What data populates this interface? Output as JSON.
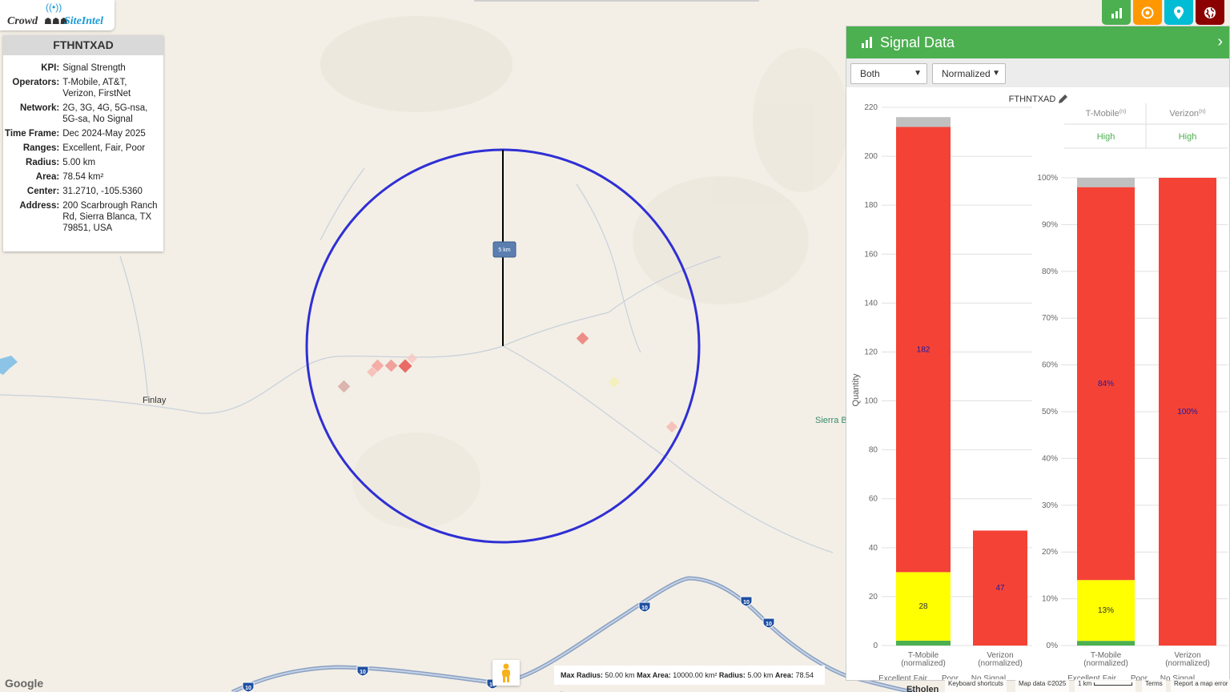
{
  "logo": {
    "crowd": "Crowd",
    "site": "SiteIntel"
  },
  "info": {
    "title": "FTHNTXAD",
    "rows": [
      {
        "k": "KPI:",
        "v": "Signal Strength"
      },
      {
        "k": "Operators:",
        "v": "T-Mobile, AT&T, Verizon, FirstNet"
      },
      {
        "k": "Network:",
        "v": "2G, 3G, 4G, 5G-nsa, 5G-sa, No Signal"
      },
      {
        "k": "Time Frame:",
        "v": "Dec 2024-May 2025"
      },
      {
        "k": "Ranges:",
        "v": "Excellent, Fair, Poor"
      },
      {
        "k": "Radius:",
        "v": "5.00 km"
      },
      {
        "k": "Area:",
        "v": "78.54 km²"
      },
      {
        "k": "Center:",
        "v": "31.2710, -105.5360"
      },
      {
        "k": "Address:",
        "v": "200 Scarbrough Ranch Rd, Sierra Blanca, TX 79851, USA"
      }
    ]
  },
  "map": {
    "labels": {
      "finlay": "Finlay",
      "sierra": "Sierra B",
      "etholen": "Etholen",
      "radius_label": "5 km"
    },
    "shields": [
      "10",
      "10",
      "10",
      "10",
      "10",
      "10"
    ],
    "max_bar": {
      "k1": "Max Radius:",
      "v1": "50.00 km",
      "k2": "Max Area:",
      "v2": "10000.00 km²",
      "k3": "Radius:",
      "v3": "5.00 km",
      "k4": "Area:",
      "v4": "78.54 km²"
    },
    "google": "Google",
    "footer": {
      "keyboard": "Keyboard shortcuts",
      "mapdata": "Map data ©2025",
      "scale": "1 km",
      "terms": "Terms",
      "report": "Report a map error"
    },
    "circle_color": "#2f2fd4"
  },
  "buttons": [
    {
      "name": "chart-icon",
      "color": "#4caf50"
    },
    {
      "name": "target-icon",
      "color": "#ff9800"
    },
    {
      "name": "location-pin-icon",
      "color": "#00bcd4"
    },
    {
      "name": "globe-icon",
      "color": "#8b0000"
    }
  ],
  "panel": {
    "title": "Signal Data",
    "select_operator": "Both",
    "select_mode": "Normalized",
    "chart_title": "FTHNTXAD"
  },
  "chart_data": [
    {
      "type": "bar",
      "stacked": true,
      "title": "FTHNTXAD",
      "ylabel": "Quantity",
      "ylim": [
        0,
        220
      ],
      "yticks": [
        0,
        20,
        40,
        60,
        80,
        100,
        120,
        140,
        160,
        180,
        200,
        220
      ],
      "categories": [
        "T-Mobile (normalized)",
        "Verizon (normalized)"
      ],
      "category_lines": [
        [
          "T-Mobile",
          "(normalized)"
        ],
        [
          "Verizon",
          "(normalized)"
        ]
      ],
      "series": [
        {
          "name": "Excellent",
          "color": "#4caf50",
          "values": [
            2,
            0
          ]
        },
        {
          "name": "Fair",
          "color": "#ffff00",
          "values": [
            28,
            0
          ]
        },
        {
          "name": "Poor",
          "color": "#f44336",
          "values": [
            182,
            47
          ]
        },
        {
          "name": "No Signal",
          "color": "#c0c0c0",
          "values": [
            4,
            0
          ]
        }
      ],
      "data_labels": [
        [
          "",
          "28",
          "182",
          ""
        ],
        [
          "",
          "",
          "47",
          ""
        ]
      ]
    },
    {
      "type": "bar",
      "stacked": true,
      "ylim": [
        0,
        100
      ],
      "yticks": [
        "0%",
        "10%",
        "20%",
        "30%",
        "40%",
        "50%",
        "60%",
        "70%",
        "80%",
        "90%",
        "100%"
      ],
      "categories": [
        "T-Mobile (normalized)",
        "Verizon (normalized)"
      ],
      "category_lines": [
        [
          "T-Mobile",
          "(normalized)"
        ],
        [
          "Verizon",
          "(normalized)"
        ]
      ],
      "headers": [
        {
          "name": "T-Mobile",
          "sup": "(n)",
          "level": "High"
        },
        {
          "name": "Verizon",
          "sup": "(n)",
          "level": "High"
        }
      ],
      "series": [
        {
          "name": "Excellent",
          "color": "#4caf50",
          "values": [
            1,
            0
          ]
        },
        {
          "name": "Fair",
          "color": "#ffff00",
          "values": [
            13,
            0
          ]
        },
        {
          "name": "Poor",
          "color": "#f44336",
          "values": [
            84,
            100
          ]
        },
        {
          "name": "No Signal",
          "color": "#c0c0c0",
          "values": [
            2,
            0
          ]
        }
      ],
      "data_labels": [
        [
          "",
          "13%",
          "84%",
          ""
        ],
        [
          "",
          "",
          "100%",
          ""
        ]
      ]
    }
  ]
}
